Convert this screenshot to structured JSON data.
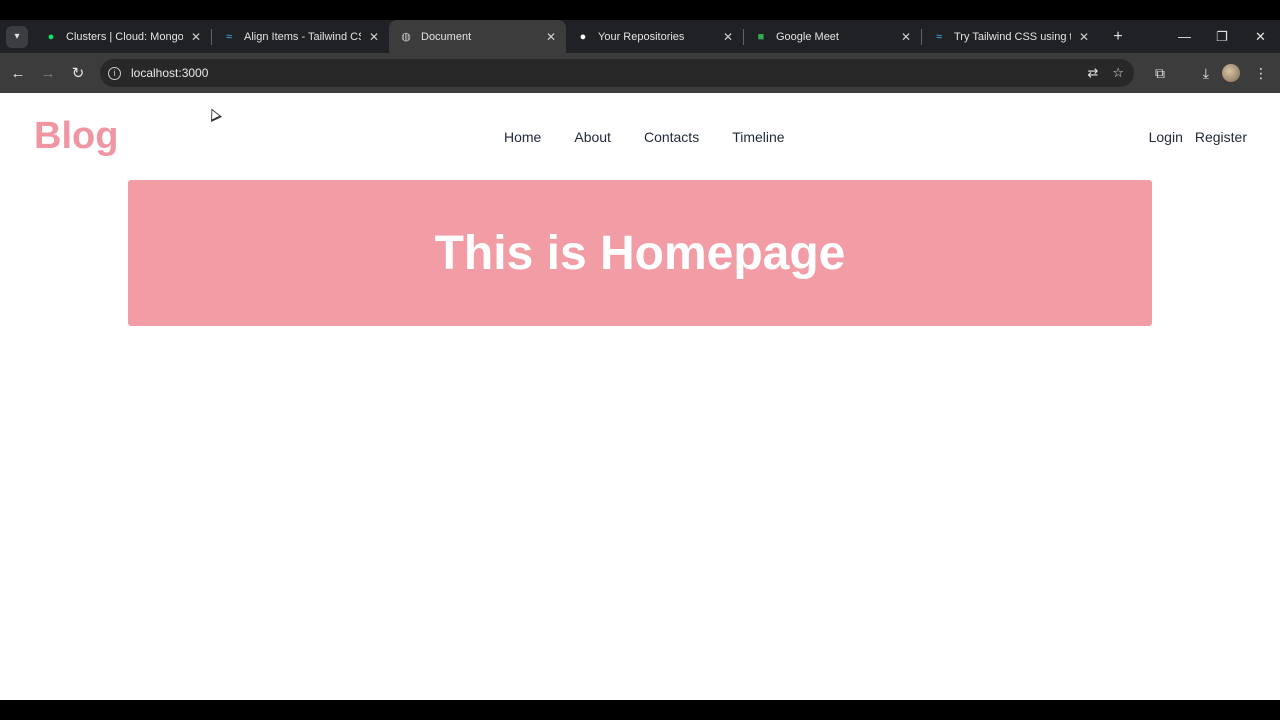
{
  "browser": {
    "tabs": [
      {
        "title": "Clusters | Cloud: MongoDB",
        "icon": "mongodb-leaf-icon"
      },
      {
        "title": "Align Items - Tailwind CSS",
        "icon": "tailwind-icon"
      },
      {
        "title": "Document",
        "icon": "globe-icon"
      },
      {
        "title": "Your Repositories",
        "icon": "github-icon"
      },
      {
        "title": "Google Meet",
        "icon": "google-meet-icon"
      },
      {
        "title": "Try Tailwind CSS using the",
        "icon": "tailwind-icon"
      }
    ],
    "url": "localhost:3000"
  },
  "site": {
    "brand": "Blog",
    "nav": [
      "Home",
      "About",
      "Contacts",
      "Timeline"
    ],
    "auth": {
      "login": "Login",
      "register": "Register"
    },
    "hero_title": "This is Homepage"
  },
  "colors": {
    "brand": "#f096a3",
    "hero_bg": "#f29ca6"
  }
}
